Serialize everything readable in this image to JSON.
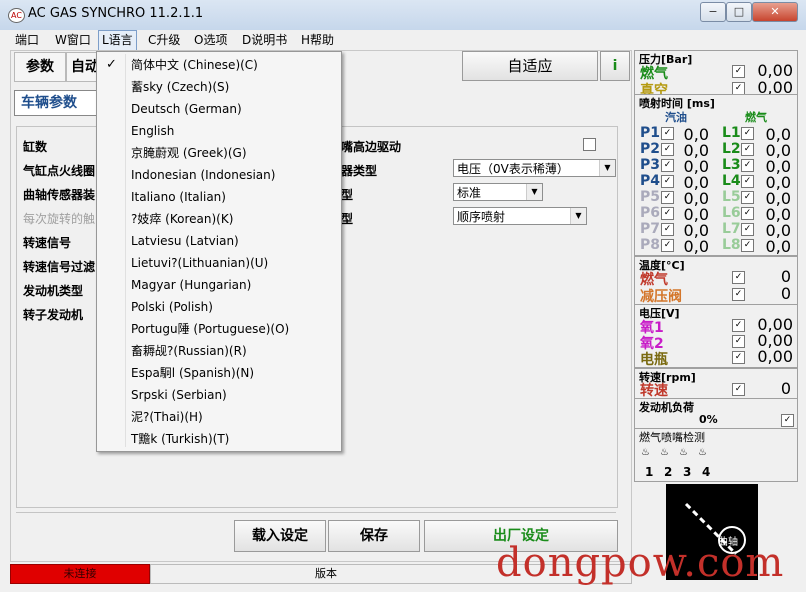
{
  "window": {
    "title": "AC GAS SYNCHRO  11.2.1.1",
    "icon": "AC",
    "controls": {
      "minimize": "−",
      "maximize": "□",
      "close": "✕"
    }
  },
  "menu": [
    {
      "label": "端口"
    },
    {
      "label": "W窗口"
    },
    {
      "label": "L语言"
    },
    {
      "label": "C升级"
    },
    {
      "label": "O选项"
    },
    {
      "label": "D说明书"
    },
    {
      "label": "H帮助"
    }
  ],
  "languages": [
    {
      "label": "简体中文 (Chinese)(C)",
      "checked": true
    },
    {
      "label": "蓄sky (Czech)(S)"
    },
    {
      "label": "Deutsch (German)"
    },
    {
      "label": "English"
    },
    {
      "label": "京腌蔚观 (Greek)(G)"
    },
    {
      "label": "Indonesian (Indonesian)"
    },
    {
      "label": "Italiano (Italian)"
    },
    {
      "label": "?妓瘁 (Korean)(K)"
    },
    {
      "label": "Latviesu (Latvian)"
    },
    {
      "label": "Lietuvi?(Lithuanian)(U)"
    },
    {
      "label": "Magyar (Hungarian)"
    },
    {
      "label": "Polski (Polish)"
    },
    {
      "label": "Portugu陲 (Portuguese)(O)"
    },
    {
      "label": "畜耨觇?(Russian)(R)"
    },
    {
      "label": "Espa駉l (Spanish)(N)"
    },
    {
      "label": "Srpski (Serbian)"
    },
    {
      "label": "泥?(Thai)(H)"
    },
    {
      "label": "T黵k (Turkish)(T)"
    }
  ],
  "main": {
    "tabs": [
      "参数",
      "自动"
    ],
    "section_tab": "车辆参数",
    "adaptive_button": "自适应",
    "params": [
      {
        "label": "缸数"
      },
      {
        "label": "气缸点火线圈"
      },
      {
        "label": "曲轴传感器装"
      },
      {
        "label": "每次旋转的触",
        "disabled": true
      },
      {
        "label": "转速信号"
      },
      {
        "label": "转速信号过滤"
      },
      {
        "label": "发动机类型"
      },
      {
        "label": "转子发动机"
      }
    ],
    "right_params": [
      {
        "label": "嘴高边驱动"
      },
      {
        "label": "器类型",
        "value": "电压（0V表示稀薄）"
      },
      {
        "label": "型",
        "value": "标准"
      },
      {
        "label": "型",
        "value": "顺序喷射"
      }
    ],
    "buttons": {
      "load": "载入设定",
      "save": "保存",
      "factory": "出厂设定"
    }
  },
  "status": {
    "left": "未连接",
    "version_label": "版本"
  },
  "watermark": "dongpow.com",
  "panel": {
    "pressure": {
      "title": "压力[Bar]",
      "rows": [
        {
          "label": "燃气",
          "value": "0,00",
          "color": "#1a8c1a"
        },
        {
          "label": "真空",
          "value": "0,00",
          "color": "#b59a10"
        }
      ]
    },
    "injection": {
      "title": "喷射时间 [ms]",
      "col_petrol": "汽油",
      "col_gas": "燃气",
      "petrol": [
        "P1",
        "P2",
        "P3",
        "P4",
        "P5",
        "P6",
        "P7",
        "P8"
      ],
      "gas": [
        "L1",
        "L2",
        "L3",
        "L4",
        "L5",
        "L6",
        "L7",
        "L8"
      ],
      "value": "0,0"
    },
    "temperature": {
      "title": "温度[°C]",
      "rows": [
        {
          "label": "燃气",
          "value": "0",
          "color": "#c0392b"
        },
        {
          "label": "减压阀",
          "value": "0",
          "color": "#d4762a"
        }
      ]
    },
    "voltage": {
      "title": "电压[V]",
      "rows": [
        {
          "label": "氧1",
          "value": "0,00",
          "color": "#c81cc8"
        },
        {
          "label": "氧2",
          "value": "0,00",
          "color": "#c81cc8"
        },
        {
          "label": "电瓶",
          "value": "0,00",
          "color": "#7a6a10"
        }
      ]
    },
    "rpm": {
      "title": "转速[rpm]",
      "label": "转速",
      "value": "0",
      "color": "#c0392b"
    },
    "load": {
      "title": "发动机负荷",
      "value": "0%"
    },
    "injector_test": {
      "title": "燃气喷嘴检测",
      "numbers": [
        "1",
        "2",
        "3",
        "4"
      ]
    },
    "diagram_label": "曲轴"
  }
}
